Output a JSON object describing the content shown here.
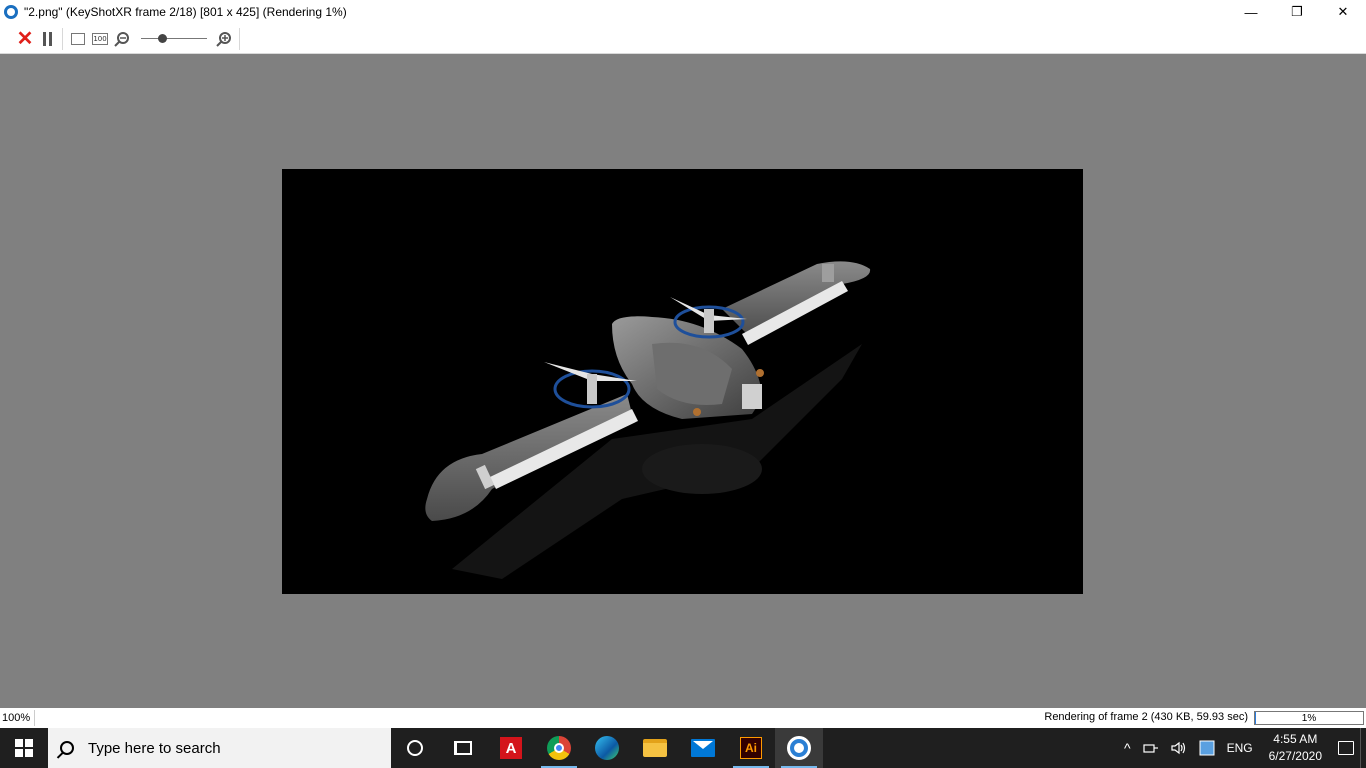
{
  "window": {
    "title": "\"2.png\" (KeyShotXR frame 2/18) [801 x 425] (Rendering 1%)",
    "minimize": "—",
    "maximize": "❐",
    "close": "✕"
  },
  "toolbar": {
    "hundred_label": "100",
    "zoom_level": 0.3
  },
  "render": {
    "subject": "KeyShotXR drone render"
  },
  "status": {
    "zoom": "100%",
    "message": "Rendering of frame 2 (430 KB, 59.93 sec)",
    "progress_label": "1%",
    "progress_value": 0.01
  },
  "taskbar": {
    "search_placeholder": "Type here to search",
    "acrobat_label": "A",
    "ai_label": "Ai",
    "tray_chevron": "^",
    "language": "ENG",
    "time": "4:55 AM",
    "date": "6/27/2020"
  },
  "colors": {
    "canvas_bg": "#808080",
    "accent": "#2a7de1"
  }
}
